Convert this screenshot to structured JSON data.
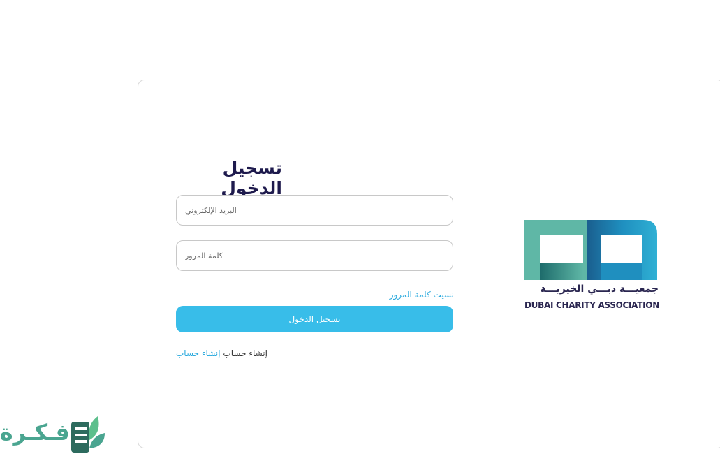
{
  "login": {
    "title": "تسجيل الدخول",
    "email_placeholder": "البريد الإلكتروني",
    "password_placeholder": "كلمة المرور",
    "forgot_password": "نسيت كلمة المرور",
    "submit_label": "تسجيل الدخول",
    "signup_text": "إنشاء حساب",
    "signup_link": "إنشاء حساب"
  },
  "logo": {
    "arabic": "جمعيـــة دبـــي الخيريـــة",
    "english": "DUBAI CHARITY ASSOCIATION"
  },
  "watermark": {
    "text": "فـكـرة"
  },
  "colors": {
    "title": "#1e1a4d",
    "accent": "#38bde9",
    "link": "#29a9dd",
    "logo_teal": "#5fb7a6",
    "logo_blue": "#1f8fbf"
  }
}
